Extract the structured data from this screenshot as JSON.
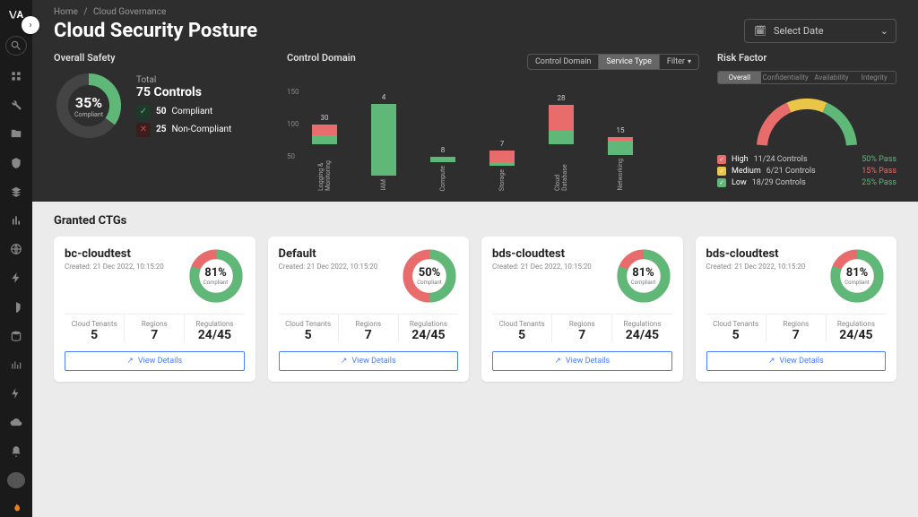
{
  "breadcrumb": {
    "home": "Home",
    "current": "Cloud Governance"
  },
  "page_title": "Cloud Security Posture",
  "date_picker": "Select Date",
  "overall_safety": {
    "label": "Overall Safety",
    "pct": "35%",
    "pct_sub": "Compliant",
    "total_label": "Total",
    "total_value": "75 Controls",
    "compliant_n": "50",
    "compliant_l": "Compliant",
    "noncompliant_n": "25",
    "noncompliant_l": "Non-Compliant"
  },
  "control_domain": {
    "label": "Control Domain",
    "segments": {
      "cd": "Control Domain",
      "st": "Service Type",
      "ft": "Filter"
    }
  },
  "chart_data": {
    "type": "bar",
    "ylim": [
      0,
      150
    ],
    "yticks": [
      "150",
      "100",
      "50"
    ],
    "series_colors": {
      "compliant": "#5fb878",
      "noncompliant": "#e86c6c"
    },
    "bars": [
      {
        "label": "Logging & Monitoring",
        "total": 30,
        "compliant": 14,
        "noncompliant": 16
      },
      {
        "label": "IAM",
        "total": 4,
        "compliant": 110,
        "noncompliant": 0,
        "display_total": 110
      },
      {
        "label": "Compute",
        "total": 8,
        "compliant": 6,
        "noncompliant": 2
      },
      {
        "label": "Storage",
        "total": 7,
        "compliant": 5,
        "noncompliant": 18
      },
      {
        "label": "Cloud Database",
        "total": 28,
        "compliant": 20,
        "noncompliant": 40
      },
      {
        "label": "Networking",
        "total": 15,
        "compliant": 22,
        "noncompliant": 6
      }
    ]
  },
  "risk_factor": {
    "label": "Risk Factor",
    "tabs": {
      "ov": "Overall",
      "cf": "Confidentiality",
      "av": "Availability",
      "in": "Integrity"
    },
    "rows": [
      {
        "level": "High",
        "color": "#e86c6c",
        "ctrls": "11/24 Controls",
        "pass": "50% Pass",
        "pcolor": "#5fb878"
      },
      {
        "level": "Medium",
        "color": "#e9c647",
        "ctrls": "6/21 Controls",
        "pass": "15% Pass",
        "pcolor": "#e86c6c"
      },
      {
        "level": "Low",
        "color": "#5fb878",
        "ctrls": "18/29 Controls",
        "pass": "25% Pass",
        "pcolor": "#5fb878"
      }
    ]
  },
  "granted_label": "Granted CTGs",
  "view_details": "View Details",
  "metrics_labels": {
    "tenants": "Cloud Tenants",
    "regions": "Regions",
    "regs": "Regulations"
  },
  "cards": [
    {
      "name": "bc-cloudtest",
      "created": "Created: 21 Dec 2022, 10:15:20",
      "pct": "81%",
      "compliant": 81,
      "tenants": "5",
      "regions": "7",
      "regs": "24/45"
    },
    {
      "name": "Default",
      "created": "Created: 21 Dec 2022, 10:15:20",
      "pct": "50%",
      "compliant": 50,
      "tenants": "5",
      "regions": "7",
      "regs": "24/45"
    },
    {
      "name": "bds-cloudtest",
      "created": "Created: 21 Dec 2022, 10:15:20",
      "pct": "81%",
      "compliant": 81,
      "tenants": "5",
      "regions": "7",
      "regs": "24/45"
    },
    {
      "name": "bds-cloudtest",
      "created": "Created: 21 Dec 2022, 10:15:20",
      "pct": "81%",
      "compliant": 81,
      "tenants": "5",
      "regions": "7",
      "regs": "24/45"
    }
  ]
}
